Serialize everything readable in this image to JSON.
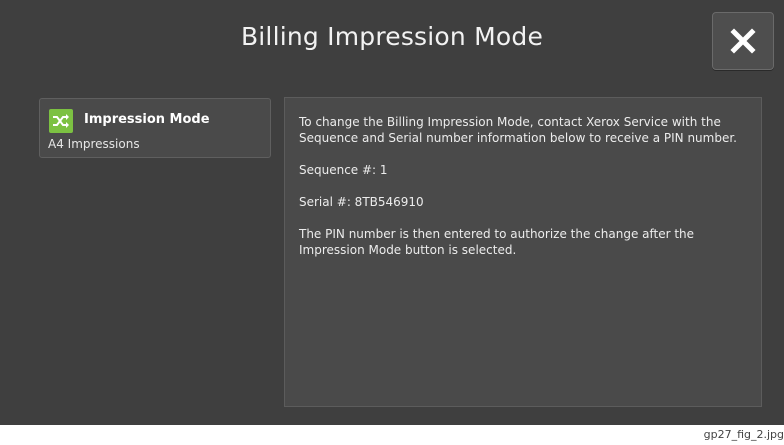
{
  "dialog": {
    "title": "Billing Impression Mode",
    "close_icon": "close-icon"
  },
  "impression_mode": {
    "label": "Impression Mode",
    "value": "A4 Impressions",
    "icon": "shuffle-icon",
    "icon_color": "#7cc142"
  },
  "info": {
    "paragraph_1": "To change the Billing Impression Mode, contact Xerox Service with the Sequence and Serial number information below to receive a PIN number.",
    "sequence": "Sequence #: 1",
    "serial": "Serial #: 8TB546910",
    "paragraph_2": "The PIN number is then entered to authorize the change after the Impression Mode button is selected."
  },
  "caption": "gp27_fig_2.jpg"
}
